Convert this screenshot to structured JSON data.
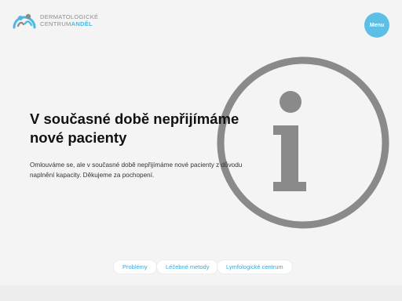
{
  "brand": {
    "line1": "DERMATOLOGICKÉ",
    "line2_main": "CENTRUM",
    "line2_accent": "ANDĚL"
  },
  "header": {
    "menu_label": "Menu"
  },
  "main": {
    "headline": "V současné době nepřijímáme nové pacienty",
    "body": "Omlouváme se, ale v současné době nepřijímáme nové pacienty z důvodu naplnění kapacity. Děkujeme za pochopení."
  },
  "links": [
    "Problémy",
    "Léčebné metody",
    "Lymfologické centrum"
  ],
  "colors": {
    "accent": "#5bbfe6",
    "link": "#3aa6d6",
    "icon_gray": "#8a8a8a",
    "background": "#f4f4f4"
  },
  "icons": {
    "logo": "people-arc-logo-icon",
    "info": "info-circle-icon"
  }
}
